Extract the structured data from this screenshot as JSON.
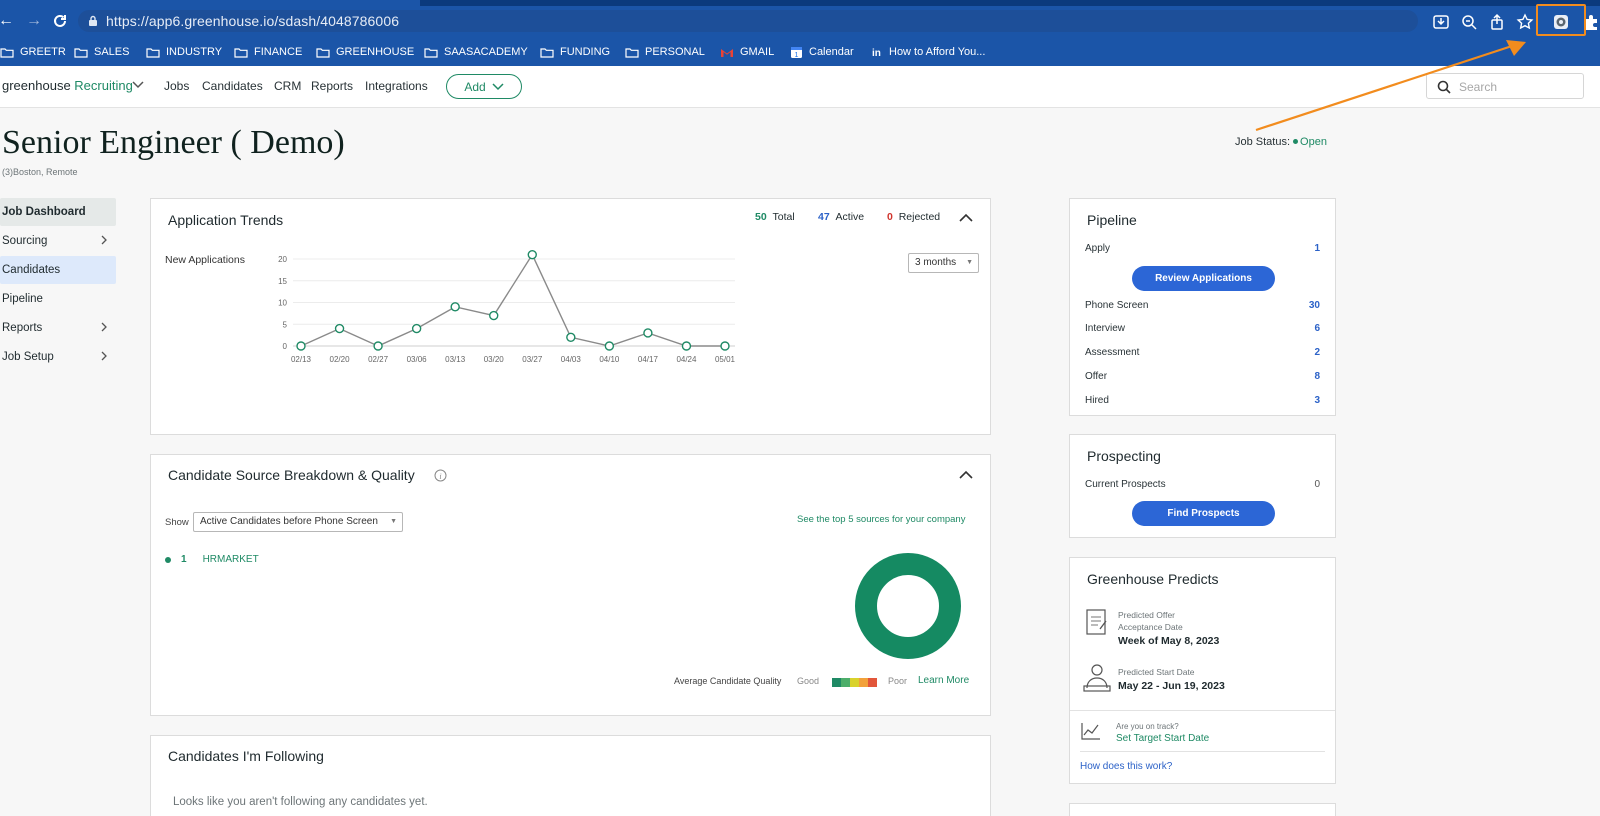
{
  "browser": {
    "url": "https://app6.greenhouse.io/sdash/4048786006",
    "bookmarks": [
      {
        "label": "GREETR",
        "icon": "folder-icon"
      },
      {
        "label": "SALES",
        "icon": "folder-icon"
      },
      {
        "label": "INDUSTRY",
        "icon": "folder-icon"
      },
      {
        "label": "FINANCE",
        "icon": "folder-icon"
      },
      {
        "label": "GREENHOUSE",
        "icon": "folder-icon"
      },
      {
        "label": "SAASACADEMY",
        "icon": "folder-icon"
      },
      {
        "label": "FUNDING",
        "icon": "folder-icon"
      },
      {
        "label": "PERSONAL",
        "icon": "folder-icon"
      },
      {
        "label": "GMAIL",
        "icon": "gmail-icon"
      },
      {
        "label": "Calendar",
        "icon": "calendar-icon"
      },
      {
        "label": "How to Afford You...",
        "icon": "linkedin-icon"
      }
    ]
  },
  "app": {
    "logo_main": "greenhouse",
    "logo_sub": "Recruiting",
    "nav": [
      "Jobs",
      "Candidates",
      "CRM",
      "Reports",
      "Integrations"
    ],
    "add_label": "Add",
    "search_placeholder": "Search"
  },
  "job": {
    "title": "Senior Engineer ( Demo)",
    "location": "(3)Boston, Remote",
    "status_label": "Job Status:",
    "status_value": "Open"
  },
  "sidebar": [
    {
      "label": "Job Dashboard",
      "chevron": false
    },
    {
      "label": "Sourcing",
      "chevron": true
    },
    {
      "label": "Candidates",
      "chevron": false
    },
    {
      "label": "Pipeline",
      "chevron": false
    },
    {
      "label": "Reports",
      "chevron": true
    },
    {
      "label": "Job Setup",
      "chevron": true
    }
  ],
  "trends": {
    "title": "Application Trends",
    "total": "50",
    "total_label": "Total",
    "active": "47",
    "active_label": "Active",
    "rejected": "0",
    "rejected_label": "Rejected",
    "range": "3 months"
  },
  "chart_data": {
    "type": "line",
    "ylabel": "New Applications",
    "x": [
      "02/13",
      "02/20",
      "02/27",
      "03/06",
      "03/13",
      "03/20",
      "03/27",
      "04/03",
      "04/10",
      "04/17",
      "04/24",
      "05/01"
    ],
    "values": [
      0,
      4,
      0,
      4,
      9,
      7,
      21,
      2,
      0,
      3,
      0,
      0
    ],
    "ylim": [
      0,
      20
    ],
    "yticks": [
      "20",
      "15",
      "10",
      "5",
      "0"
    ],
    "grid": true,
    "color": "#1f8a65"
  },
  "source": {
    "title": "Candidate Source Breakdown & Quality",
    "show_label": "Show",
    "filter": "Active Candidates before Phone Screen",
    "top_link": "See the top 5 sources for your company",
    "items": [
      {
        "count": "1",
        "name": "HRMARKET"
      }
    ],
    "quality_label": "Average Candidate Quality",
    "good": "Good",
    "poor": "Poor",
    "learn_more": "Learn More",
    "quality_colors": [
      "#1f8a65",
      "#4cae6a",
      "#d9d22c",
      "#f2a13a",
      "#e2563a"
    ]
  },
  "following": {
    "title": "Candidates I'm Following",
    "empty": "Looks like you aren't following any candidates yet."
  },
  "pipeline": {
    "title": "Pipeline",
    "apply_label": "Apply",
    "apply_count": "1",
    "review_btn": "Review Applications",
    "stages": [
      {
        "label": "Phone Screen",
        "count": "30"
      },
      {
        "label": "Interview",
        "count": "6"
      },
      {
        "label": "Assessment",
        "count": "2"
      },
      {
        "label": "Offer",
        "count": "8"
      },
      {
        "label": "Hired",
        "count": "3"
      }
    ]
  },
  "prospecting": {
    "title": "Prospecting",
    "current_label": "Current Prospects",
    "current_count": "0",
    "find_btn": "Find Prospects"
  },
  "predicts": {
    "title": "Greenhouse Predicts",
    "offer_label_1": "Predicted Offer",
    "offer_label_2": "Acceptance Date",
    "offer_value": "Week of May 8, 2023",
    "start_label": "Predicted Start Date",
    "start_value": "May 22 - Jun 19, 2023",
    "track_question": "Are you on track?",
    "set_target": "Set Target Start Date",
    "how_link": "How does this work?"
  }
}
